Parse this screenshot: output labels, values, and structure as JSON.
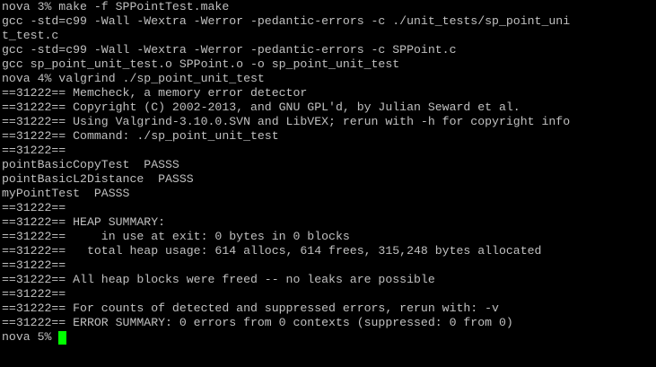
{
  "terminal": {
    "lines": [
      "nova 3% make -f SPPointTest.make",
      "gcc -std=c99 -Wall -Wextra -Werror -pedantic-errors -c ./unit_tests/sp_point_uni",
      "t_test.c",
      "gcc -std=c99 -Wall -Wextra -Werror -pedantic-errors -c SPPoint.c",
      "gcc sp_point_unit_test.o SPPoint.o -o sp_point_unit_test",
      "nova 4% valgrind ./sp_point_unit_test",
      "==31222== Memcheck, a memory error detector",
      "==31222== Copyright (C) 2002-2013, and GNU GPL'd, by Julian Seward et al.",
      "==31222== Using Valgrind-3.10.0.SVN and LibVEX; rerun with -h for copyright info",
      "==31222== Command: ./sp_point_unit_test",
      "==31222==",
      "pointBasicCopyTest  PASSS",
      "pointBasicL2Distance  PASSS",
      "myPointTest  PASSS",
      "==31222==",
      "==31222== HEAP SUMMARY:",
      "==31222==     in use at exit: 0 bytes in 0 blocks",
      "==31222==   total heap usage: 614 allocs, 614 frees, 315,248 bytes allocated",
      "==31222==",
      "==31222== All heap blocks were freed -- no leaks are possible",
      "==31222==",
      "==31222== For counts of detected and suppressed errors, rerun with: -v",
      "==31222== ERROR SUMMARY: 0 errors from 0 contexts (suppressed: 0 from 0)"
    ],
    "prompt": "nova 5% ",
    "colors": {
      "background": "#000000",
      "text": "#c0c0c0",
      "cursor": "#00ff00"
    }
  }
}
